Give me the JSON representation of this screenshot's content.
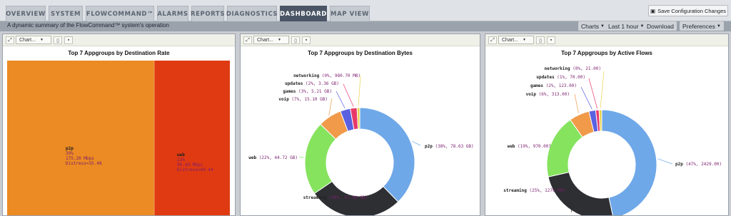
{
  "tabs": [
    {
      "label": "OVERVIEW"
    },
    {
      "label": "SYSTEM"
    },
    {
      "label": "FLOWCOMMAND™"
    },
    {
      "label": "ALARMS"
    },
    {
      "label": "REPORTS"
    },
    {
      "label": "DIAGNOSTICS"
    },
    {
      "label": "DASHBOARD",
      "active": true
    },
    {
      "label": "MAP VIEW"
    }
  ],
  "header": {
    "save_label": "Save Configuration Changes",
    "summary": "A dynamic summary of the FlowCommand™ system's operation",
    "menus": [
      "Charts",
      "Last 1 hour",
      "Download",
      "Preferences"
    ]
  },
  "panels": [
    {
      "toolbar": {
        "select": "Chart..."
      },
      "title": "Top 7 Appgroups by Destination Rate",
      "treemap": [
        {
          "name": "p2p",
          "pct": "39%",
          "rate": "175.20 Mbps",
          "distress": "Distress=35.48",
          "color": "#ec8a23"
        },
        {
          "name": "web",
          "pct": "22%",
          "rate": "99.49 Mbps",
          "distress": "Distress=49.44",
          "color": "#e03a12"
        }
      ]
    },
    {
      "toolbar": {
        "select": "Chart..."
      },
      "title": "Top 7 Appgroups by Destination Bytes"
    },
    {
      "toolbar": {
        "select": "Chart..."
      },
      "title": "Top 7 Appgroups by Active Flows"
    }
  ],
  "chart_data": [
    {
      "type": "treemap",
      "title": "Top 7 Appgroups by Destination Rate",
      "items": [
        {
          "name": "p2p",
          "percent": 39,
          "rate_mbps": 175.2,
          "distress": 35.48
        },
        {
          "name": "web",
          "percent": 22,
          "rate_mbps": 99.49,
          "distress": 49.44
        }
      ]
    },
    {
      "type": "pie",
      "title": "Top 7 Appgroups by Destination Bytes",
      "slices": [
        {
          "name": "p2p",
          "percent": 38,
          "value": "78.63 GB",
          "label": "(38%, 78.63 GB)",
          "color": "#6fa8e8"
        },
        {
          "name": "streaming",
          "percent": 28,
          "value": "57.04 GB",
          "label": "(28%, 57.04 GB)",
          "color": "#2e2f33"
        },
        {
          "name": "web",
          "percent": 22,
          "value": "44.72 GB",
          "label": "(22%, 44.72 GB)",
          "color": "#86e35e"
        },
        {
          "name": "voip",
          "percent": 7,
          "value": "15.10 GB",
          "label": "(7%, 15.10 GB)",
          "color": "#f09a4a"
        },
        {
          "name": "games",
          "percent": 3,
          "value": "5.21 GB",
          "label": "(3%, 5.21 GB)",
          "color": "#5a61e0"
        },
        {
          "name": "updates",
          "percent": 2,
          "value": "3.36 GB",
          "label": "(2%, 3.36 GB)",
          "color": "#e8396a"
        },
        {
          "name": "networking",
          "percent": 0,
          "value": "980.70 MB",
          "label": "(0%, 980.70 MB)",
          "color": "#e8d24a"
        }
      ]
    },
    {
      "type": "pie",
      "title": "Top 7 Appgroups by Active Flows",
      "slices": [
        {
          "name": "p2p",
          "percent": 47,
          "value": 2429.0,
          "label": "(47%, 2429.00)",
          "color": "#6fa8e8"
        },
        {
          "name": "streaming",
          "percent": 25,
          "value": 1279.0,
          "label": "(25%, 1279.00)",
          "color": "#2e2f33"
        },
        {
          "name": "web",
          "percent": 19,
          "value": 970.0,
          "label": "(19%, 970.00)",
          "color": "#86e35e"
        },
        {
          "name": "voip",
          "percent": 6,
          "value": 313.0,
          "label": "(6%, 313.00)",
          "color": "#f09a4a"
        },
        {
          "name": "games",
          "percent": 2,
          "value": 123.0,
          "label": "(2%, 123.00)",
          "color": "#5a61e0"
        },
        {
          "name": "updates",
          "percent": 1,
          "value": 70.0,
          "label": "(1%, 70.00)",
          "color": "#e8396a"
        },
        {
          "name": "networking",
          "percent": 0,
          "value": 21.0,
          "label": "(0%, 21.00)",
          "color": "#e8d24a"
        }
      ]
    }
  ]
}
